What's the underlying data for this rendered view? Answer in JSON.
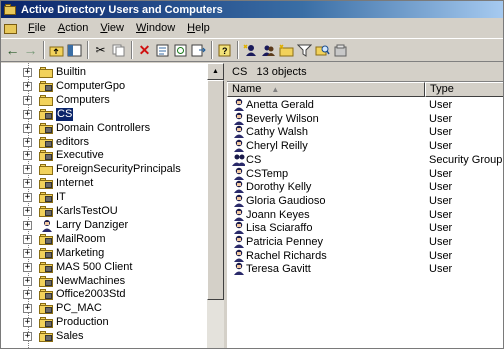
{
  "window": {
    "title": "Active Directory Users and Computers"
  },
  "menu": [
    "File",
    "Action",
    "View",
    "Window",
    "Help"
  ],
  "toolbar": {
    "icons": [
      "back-arrow-icon",
      "forward-arrow-icon",
      "up-folder-icon",
      "show-tree-icon",
      "cut-icon",
      "copy-icon",
      "delete-icon",
      "properties-icon",
      "refresh-icon",
      "export-list-icon",
      "help-icon",
      "new-user-icon",
      "new-group-icon",
      "new-ou-icon",
      "filter-icon",
      "find-icon",
      "add-to-group-icon"
    ]
  },
  "tree": {
    "selected": "CS",
    "items": [
      {
        "label": "Builtin",
        "kind": "container"
      },
      {
        "label": "ComputerGpo",
        "kind": "ou"
      },
      {
        "label": "Computers",
        "kind": "container"
      },
      {
        "label": "CS",
        "kind": "ou"
      },
      {
        "label": "Domain Controllers",
        "kind": "ou"
      },
      {
        "label": "editors",
        "kind": "ou"
      },
      {
        "label": "Executive",
        "kind": "ou"
      },
      {
        "label": "ForeignSecurityPrincipals",
        "kind": "container"
      },
      {
        "label": "Internet",
        "kind": "ou"
      },
      {
        "label": "IT",
        "kind": "ou"
      },
      {
        "label": "KarlsTestOU",
        "kind": "ou"
      },
      {
        "label": "Larry Danziger",
        "kind": "user"
      },
      {
        "label": "MailRoom",
        "kind": "ou"
      },
      {
        "label": "Marketing",
        "kind": "ou"
      },
      {
        "label": "MAS 500 Client",
        "kind": "ou"
      },
      {
        "label": "NewMachines",
        "kind": "ou"
      },
      {
        "label": "Office2003Std",
        "kind": "ou"
      },
      {
        "label": "PC_MAC",
        "kind": "ou"
      },
      {
        "label": "Production",
        "kind": "ou"
      },
      {
        "label": "Sales",
        "kind": "ou"
      }
    ]
  },
  "right": {
    "header_name": "CS",
    "header_count": "13 objects",
    "columns": {
      "name": "Name",
      "type": "Type"
    },
    "rows": [
      {
        "name": "Anetta Gerald",
        "type": "User",
        "icon": "user-icon"
      },
      {
        "name": "Beverly Wilson",
        "type": "User",
        "icon": "user-icon"
      },
      {
        "name": "Cathy Walsh",
        "type": "User",
        "icon": "user-icon"
      },
      {
        "name": "Cheryl Reilly",
        "type": "User",
        "icon": "user-icon"
      },
      {
        "name": "CS",
        "type": "Security Group ...",
        "icon": "group-icon"
      },
      {
        "name": "CSTemp",
        "type": "User",
        "icon": "user-icon"
      },
      {
        "name": "Dorothy Kelly",
        "type": "User",
        "icon": "user-icon"
      },
      {
        "name": "Gloria Gaudioso",
        "type": "User",
        "icon": "user-icon"
      },
      {
        "name": "Joann Keyes",
        "type": "User",
        "icon": "user-icon"
      },
      {
        "name": "Lisa Sciaraffo",
        "type": "User",
        "icon": "user-icon"
      },
      {
        "name": "Patricia Penney",
        "type": "User",
        "icon": "user-icon"
      },
      {
        "name": "Rachel Richards",
        "type": "User",
        "icon": "user-icon"
      },
      {
        "name": "Teresa Gavitt",
        "type": "User",
        "icon": "user-icon"
      }
    ]
  },
  "colors": {
    "title_start": "#0a246a",
    "title_end": "#a6caf0",
    "selection": "#0a246a",
    "chrome": "#d4d0c8"
  }
}
